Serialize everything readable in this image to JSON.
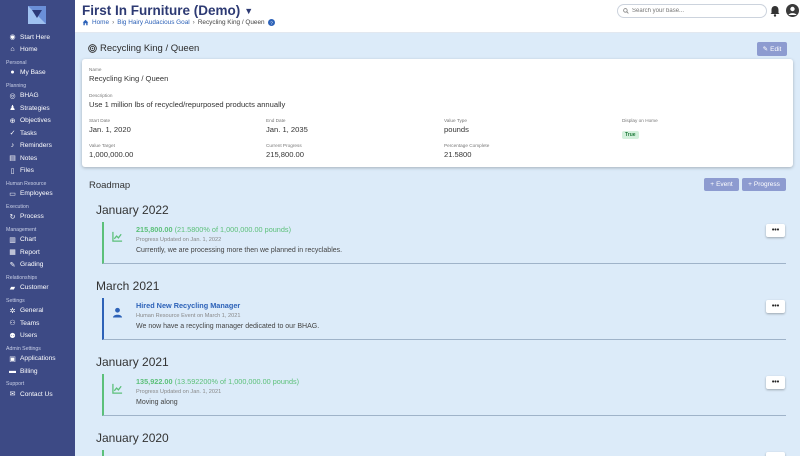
{
  "app": {
    "title": "First In Furniture (Demo)"
  },
  "breadcrumb": {
    "home": "Home",
    "parent": "Big Hairy Audacious Goal",
    "current": "Recycling King / Queen"
  },
  "search": {
    "placeholder": "Search your base..."
  },
  "sidebar": {
    "items": [
      {
        "type": "item",
        "label": "Start Here",
        "icon": "compass-icon"
      },
      {
        "type": "item",
        "label": "Home",
        "icon": "home-icon"
      },
      {
        "type": "section",
        "label": "Personal"
      },
      {
        "type": "item",
        "label": "My Base",
        "icon": "user-icon"
      },
      {
        "type": "section",
        "label": "Planning"
      },
      {
        "type": "item",
        "label": "BHAG",
        "icon": "target-icon"
      },
      {
        "type": "item",
        "label": "Strategies",
        "icon": "strategy-icon"
      },
      {
        "type": "item",
        "label": "Objectives",
        "icon": "crosshair-icon"
      },
      {
        "type": "item",
        "label": "Tasks",
        "icon": "tasks-icon"
      },
      {
        "type": "item",
        "label": "Reminders",
        "icon": "bell-icon"
      },
      {
        "type": "item",
        "label": "Notes",
        "icon": "note-icon"
      },
      {
        "type": "item",
        "label": "Files",
        "icon": "file-icon"
      },
      {
        "type": "section",
        "label": "Human Resource"
      },
      {
        "type": "item",
        "label": "Employees",
        "icon": "id-card-icon"
      },
      {
        "type": "section",
        "label": "Execution"
      },
      {
        "type": "item",
        "label": "Process",
        "icon": "process-icon"
      },
      {
        "type": "section",
        "label": "Management"
      },
      {
        "type": "item",
        "label": "Chart",
        "icon": "chart-icon"
      },
      {
        "type": "item",
        "label": "Report",
        "icon": "report-icon"
      },
      {
        "type": "item",
        "label": "Grading",
        "icon": "pen-icon"
      },
      {
        "type": "section",
        "label": "Relationships"
      },
      {
        "type": "item",
        "label": "Customer",
        "icon": "chat-icon"
      },
      {
        "type": "section",
        "label": "Settings"
      },
      {
        "type": "item",
        "label": "General",
        "icon": "gear-icon"
      },
      {
        "type": "item",
        "label": "Teams",
        "icon": "team-icon"
      },
      {
        "type": "item",
        "label": "Users",
        "icon": "users-icon"
      },
      {
        "type": "section",
        "label": "Admin Settings"
      },
      {
        "type": "item",
        "label": "Applications",
        "icon": "apps-icon"
      },
      {
        "type": "item",
        "label": "Billing",
        "icon": "billing-icon"
      },
      {
        "type": "section",
        "label": "Support"
      },
      {
        "type": "item",
        "label": "Contact Us",
        "icon": "mail-icon"
      }
    ]
  },
  "page": {
    "title": "Recycling King / Queen",
    "edit_label": "Edit"
  },
  "details": {
    "name_label": "Name",
    "name": "Recycling King / Queen",
    "description_label": "Description",
    "description": "Use 1 million lbs of recycled/repurposed products annually",
    "start_label": "Start Date",
    "start": "Jan. 1, 2020",
    "end_label": "End Date",
    "end": "Jan. 1, 2035",
    "value_type_label": "Value Type",
    "value_type": "pounds",
    "display_home_label": "Display on Home",
    "display_home": "True",
    "target_label": "Value Target",
    "target": "1,000,000.00",
    "progress_label": "Current Progress",
    "progress": "215,800.00",
    "pct_label": "Percentage Complete",
    "pct": "21.5800"
  },
  "roadmap": {
    "title": "Roadmap",
    "event_btn": "Event",
    "progress_btn": "Progress",
    "groups": [
      {
        "date": "January 2022",
        "value": "215,800.00",
        "detail": "(21.5800% of 1,000,000.00 pounds)",
        "sub": "Progress Updated on Jan. 1, 2022",
        "body": "Currently, we are processing more then we planned in recyclables.",
        "dots": "•••"
      },
      {
        "date": "March 2021",
        "value": "Hired New Recycling Manager",
        "sub": "Human Resource Event on March 1, 2021",
        "body": "We now have a recycling manager dedicated to our BHAG.",
        "dots": "•••"
      },
      {
        "date": "January 2021",
        "value": "135,922.00",
        "detail": "(13.592200% of 1,000,000.00 pounds)",
        "sub": "Progress Updated on Jan. 1, 2021",
        "body": "Moving along",
        "dots": "•••"
      },
      {
        "date": "January 2020",
        "dots": "•••"
      }
    ]
  },
  "colors": {
    "sidebar": "#3d4a85",
    "accent": "#8d9bd0",
    "progress_green": "#5cc07a",
    "event_blue": "#2d62b8",
    "background": "#dcebf9"
  }
}
